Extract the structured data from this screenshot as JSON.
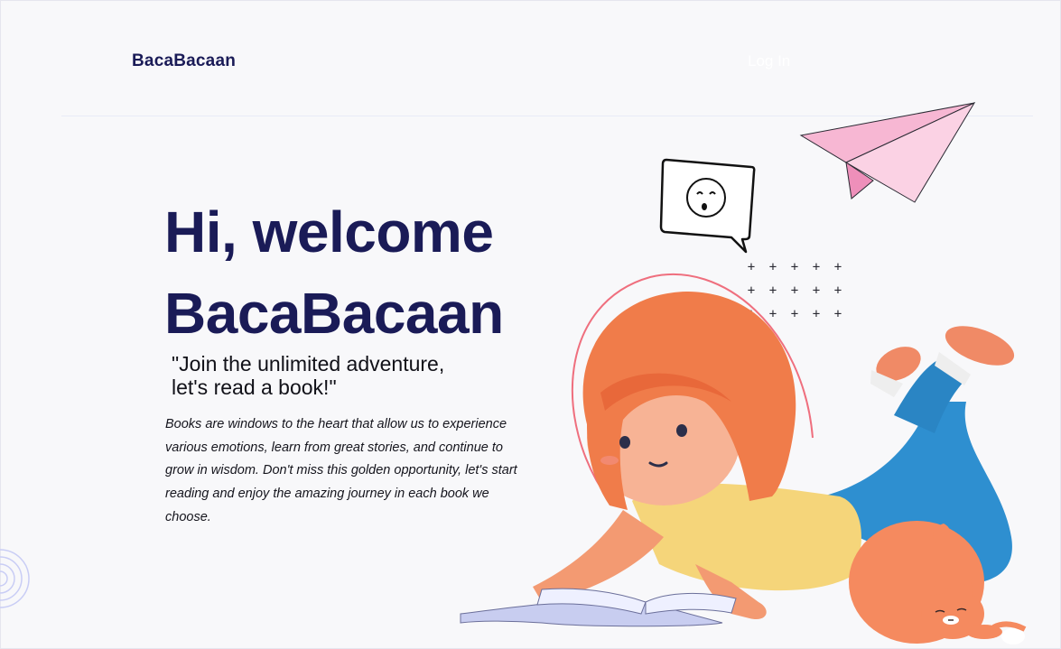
{
  "header": {
    "brand": "BacaBacaan",
    "login_label": "Log In"
  },
  "hero": {
    "title_line1": "Hi, welcome",
    "title_line2": "BacaBacaan",
    "tagline_line1": "\"Join the unlimited adventure,",
    "tagline_line2": "let's read a book!\"",
    "description": "Books are windows to the heart that allow us to experience various emotions, learn from great stories, and continue to grow in wisdom. Don't miss this golden opportunity, let's start reading and enjoy the amazing journey in each book we choose."
  },
  "decor": {
    "icons": [
      "concentric-circles-icon",
      "paper-plane-icon",
      "face-speech-bubble-icon",
      "plus-pattern-icon"
    ],
    "illustration": "girl-reading-book-with-cat"
  },
  "colors": {
    "brand": "#1a1b57",
    "background": "#f8f8fa",
    "hair": "#f07c4a",
    "shirt": "#f5d57a",
    "jeans": "#2e8fd0",
    "cat": "#f58a5f",
    "plane": "#f7b7d3"
  }
}
